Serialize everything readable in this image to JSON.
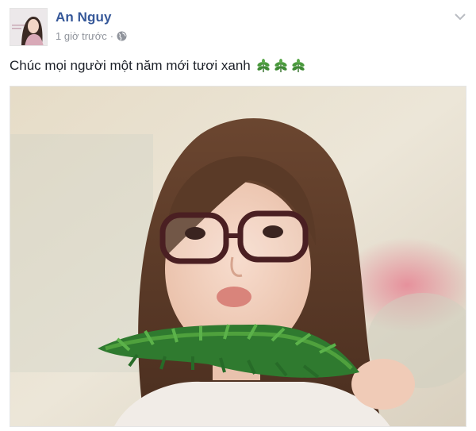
{
  "post": {
    "author_name": "An Nguy",
    "timestamp": "1 giờ trước",
    "separator": "·",
    "privacy_icon": "globe-icon",
    "menu_icon": "chevron-down-icon",
    "caption_text": "Chúc mọi người một năm mới tươi xanh",
    "caption_emojis": [
      "herb-icon",
      "herb-icon",
      "herb-icon"
    ],
    "photo": "portrait-photo"
  },
  "colors": {
    "author_link": "#365899",
    "meta_text": "#90949c",
    "caption_text": "#1d2129",
    "emoji_green": "#3f8a34"
  }
}
